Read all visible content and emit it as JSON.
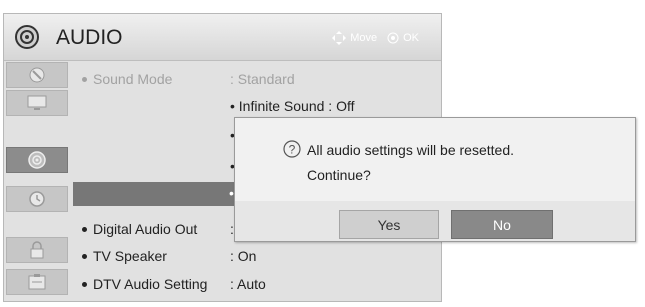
{
  "header": {
    "title": "AUDIO",
    "hint_move": "Move",
    "hint_ok": "OK",
    "icon": "speaker-icon"
  },
  "sidebar": {
    "items": [
      {
        "icon": "satellite-icon",
        "active": false
      },
      {
        "icon": "monitor-icon",
        "active": false
      },
      {
        "icon": "speaker-icon",
        "active": true
      },
      {
        "icon": "clock-icon",
        "active": false
      },
      {
        "icon": "lock-icon",
        "active": false
      },
      {
        "icon": "settings-box-icon",
        "active": false
      }
    ]
  },
  "menu": {
    "sound_mode": {
      "label": "Sound Mode",
      "value": ": Standard"
    },
    "sub_items": [
      "• Infinite Sound : Off",
      "• T",
      "• B",
      "• R"
    ],
    "digital_audio_out": {
      "label": "Digital Audio Out",
      "value": ": P"
    },
    "tv_speaker": {
      "label": "TV Speaker",
      "value": ": On"
    },
    "dtv_audio_setting": {
      "label": "DTV Audio Setting",
      "value": ": Auto"
    }
  },
  "dialog": {
    "icon": "question-icon",
    "message_line1": "All audio settings will be resetted.",
    "message_line2": "Continue?",
    "yes_label": "Yes",
    "no_label": "No"
  },
  "colors": {
    "panel": "#e1e1e1",
    "highlight": "#777777",
    "selected_button": "#898989"
  }
}
